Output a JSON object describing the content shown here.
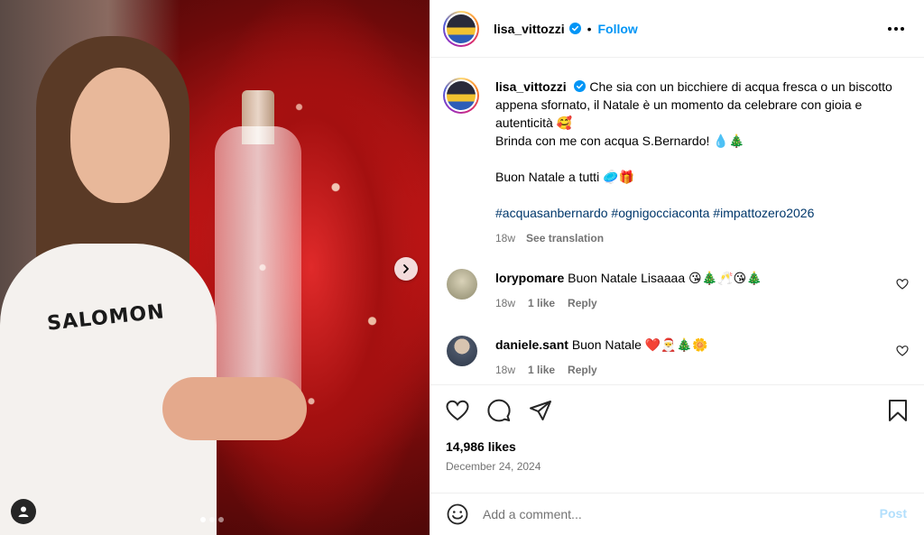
{
  "post": {
    "username": "lisa_vittozzi",
    "follow_label": "Follow",
    "separator": "•",
    "image_alt_brand": "SALOMON",
    "carousel": {
      "total": 3,
      "current": 1
    }
  },
  "caption": {
    "username": "lisa_vittozzi",
    "line1": "Che sia con un bicchiere di acqua fresca o un biscotto appena sfornato, il Natale è un momento da celebrare con gioia e autenticità 🥰",
    "line2": "Brinda con me con acqua S.Bernardo! 💧🎄",
    "line3": "Buon Natale a tutti 🥏🎁",
    "hashtags": "#acquasanbernardo #ognigocciaconta #impattozero2026",
    "age": "18w",
    "see_translation": "See translation"
  },
  "comments": [
    {
      "username": "lorypomare",
      "text": "Buon Natale Lisaaaa 😘🎄🥂😘🎄",
      "age": "18w",
      "likes": "1 like",
      "reply": "Reply"
    },
    {
      "username": "daniele.sant",
      "text": "Buon Natale ❤️🎅🎄🌼",
      "age": "18w",
      "likes": "1 like",
      "reply": "Reply"
    }
  ],
  "stats": {
    "likes": "14,986 likes",
    "date": "December 24, 2024"
  },
  "composer": {
    "placeholder": "Add a comment...",
    "post_label": "Post"
  },
  "icons": {
    "more": "more-options-icon",
    "like": "heart-icon",
    "comment": "comment-icon",
    "share": "share-icon",
    "save": "bookmark-icon",
    "emoji": "emoji-icon",
    "next": "chevron-right-icon",
    "tagged": "user-icon",
    "verified": "verified-badge-icon"
  },
  "colors": {
    "accent": "#0095f6",
    "hashtag": "#00376b",
    "muted": "#737373",
    "post_disabled": "#b2dffc"
  }
}
